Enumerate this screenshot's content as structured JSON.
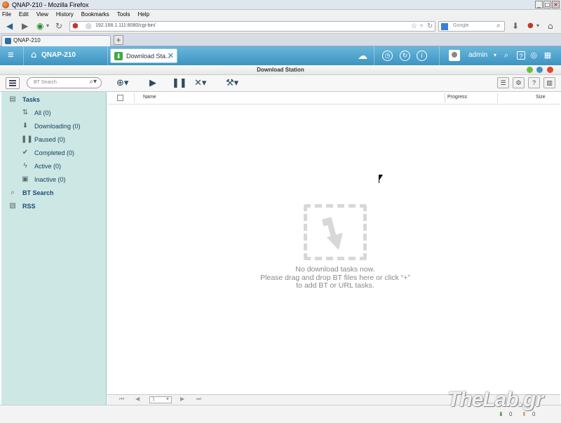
{
  "window": {
    "title": "QNAP-210 - Mozilla Firefox",
    "controls": [
      "_",
      "□",
      "×"
    ]
  },
  "menu": [
    "File",
    "Edit",
    "View",
    "History",
    "Bookmarks",
    "Tools",
    "Help"
  ],
  "navbar": {
    "url": "192.168.1.111:8080/cgi-bin/",
    "search_placeholder": "Google"
  },
  "browser_tab": {
    "label": "QNAP-210",
    "new_tab": "+"
  },
  "qts_header": {
    "nas_name": "QNAP-210",
    "app_tab": "Download Sta...",
    "user": "admin"
  },
  "app": {
    "title": "Download Station"
  },
  "toolbar": {
    "search_placeholder": "BT Search"
  },
  "sidebar": {
    "tasks_label": "Tasks",
    "items": [
      {
        "label": "All (0)",
        "icon": "all-tasks-icon"
      },
      {
        "label": "Downloading (0)",
        "icon": "download-icon"
      },
      {
        "label": "Paused (0)",
        "icon": "pause-icon"
      },
      {
        "label": "Completed (0)",
        "icon": "check-icon"
      },
      {
        "label": "Active (0)",
        "icon": "lightning-icon"
      },
      {
        "label": "Inactive (0)",
        "icon": "lock-icon"
      }
    ],
    "bt_search": "BT Search",
    "rss": "RSS"
  },
  "table": {
    "columns": [
      "Name",
      "Progress",
      "Size"
    ]
  },
  "empty_state": {
    "line1": "No download tasks now.",
    "line2": "Please drag and drop BT files here or click “+”",
    "line3": "to add BT or URL tasks."
  },
  "pager": {
    "page": "1"
  },
  "status": {
    "download_count": "0",
    "upload_count": "0"
  },
  "watermark": "TheLab.gr",
  "colors": {
    "header": "#4aa3cf",
    "sidebar": "#cde7e4",
    "app_icon": "#46a646"
  }
}
